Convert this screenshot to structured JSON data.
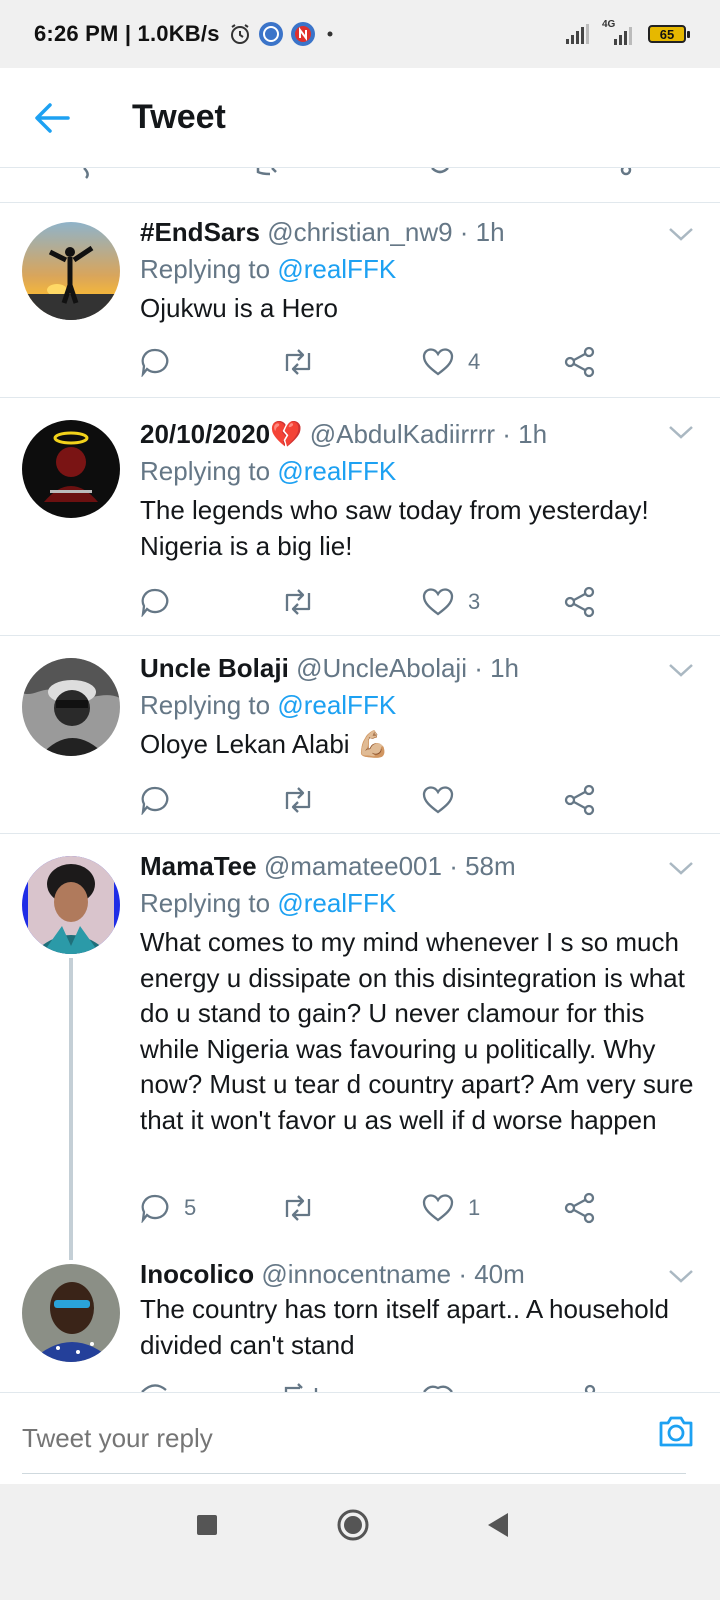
{
  "status_bar": {
    "time": "6:26 PM | 1.0KB/s",
    "network_label": "4G",
    "battery": "65"
  },
  "header": {
    "title": "Tweet"
  },
  "tweets": [
    {
      "name": "#EndSars",
      "handle": "@christian_nw9 · 1h",
      "replying_prefix": "Replying to",
      "replying_to": "@realFFK",
      "text": "Ojukwu is a Hero",
      "replies": "",
      "retweets": "",
      "likes": "4"
    },
    {
      "name": "20/10/2020💔",
      "handle": "@AbdulKadiirrrr · 1h",
      "replying_prefix": "Replying to",
      "replying_to": "@realFFK",
      "text": "The legends who saw today from yesterday! Nigeria is a big lie!",
      "replies": "",
      "retweets": "",
      "likes": "3"
    },
    {
      "name": "Uncle Bolaji",
      "handle": "@UncleAbolaji · 1h",
      "replying_prefix": "Replying to",
      "replying_to": "@realFFK",
      "text": "Oloye Lekan Alabi 💪🏼",
      "replies": "",
      "retweets": "",
      "likes": ""
    },
    {
      "name": "MamaTee",
      "handle": "@mamatee001 · 58m",
      "replying_prefix": "Replying to",
      "replying_to": "@realFFK",
      "text": "What comes to my mind whenever I s so much energy u dissipate on this disintegration is what do u stand to gain? U never clamour for this while Nigeria was favouring u politically. Why now? Must u tear d country apart? Am very sure that it won't favor u as well if d worse happen",
      "replies": "5",
      "retweets": "",
      "likes": "1"
    },
    {
      "name": "Inocolico",
      "handle": "@innocentname · 40m",
      "text": "The country has torn itself apart.. A household divided can't stand"
    }
  ],
  "composer": {
    "placeholder": "Tweet your reply"
  },
  "colors": {
    "accent": "#1da1f2",
    "secondary_text": "#657786",
    "icon": "#657786"
  }
}
